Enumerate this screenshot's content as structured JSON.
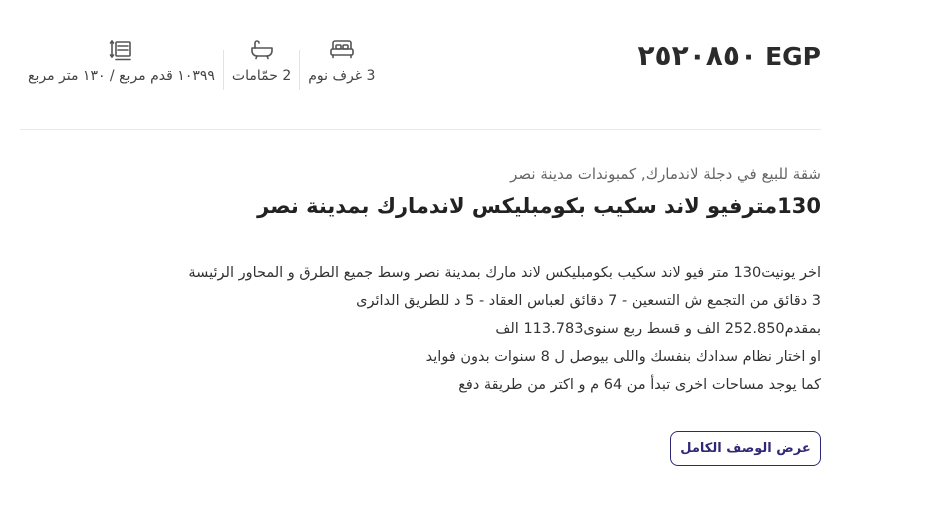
{
  "listing": {
    "price_amount": "٢٥٢٠٨٥٠",
    "currency": "EGP",
    "specs": {
      "bedrooms": "3 غرف نوم",
      "bathrooms": "2 حمّامات",
      "area": "١٠٣٩٩ قدم مربع / ١٣٠ متر مربع"
    },
    "subtitle": "شقة للبيع في دجلة لاندمارك, كمبوندات مدينة نصر",
    "title": "130مترفيو لاند سكيب بكومبليكس لاندمارك بمدينة نصر",
    "description_lines": [
      "اخر يونيت130 متر فيو لاند سكيب بكومبليكس لاند مارك بمدينة نصر وسط جميع الطرق و المحاور الرئيسة",
      "3 دقائق من التجمع ش التسعين - 7 دقائق لعباس العقاد - 5 د للطريق الدائرى",
      "بمقدم252.850 الف و قسط ربع سنوى113.783 الف",
      "او اختار نظام سدادك بنفسك واللى بيوصل ل 8 سنوات بدون فوايد",
      "كما يوجد مساحات اخرى تبدأ من 64 م و اكتر من طريقة دفع"
    ],
    "full_description_button": "عرض الوصف الكامل"
  },
  "icons": {
    "bed": "bed-icon",
    "bath": "bathtub-icon",
    "area": "area-resize-icon"
  },
  "colors": {
    "accent": "#2f2975",
    "divider": "#e9e9e9",
    "text": "#333333"
  }
}
